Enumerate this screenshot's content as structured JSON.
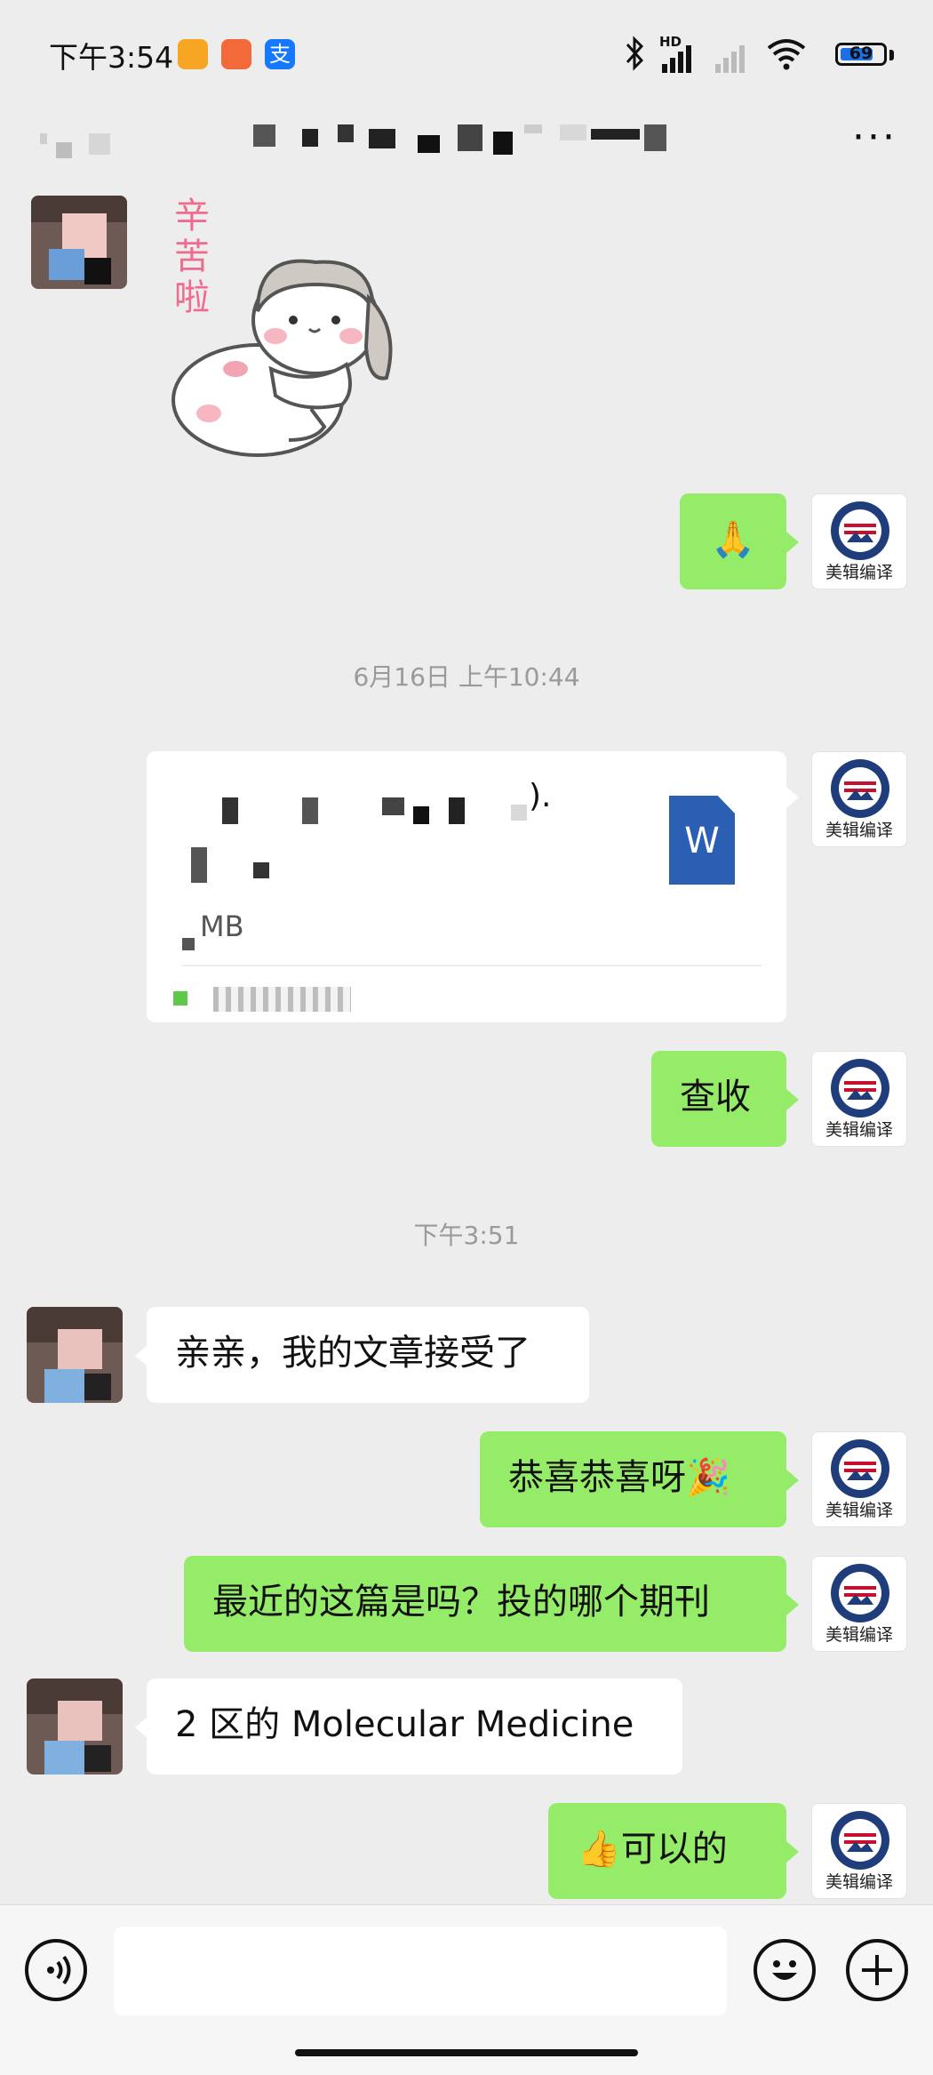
{
  "status_bar": {
    "time": "下午3:54",
    "alipay_glyph": "支",
    "battery": "69",
    "network_label": "HD",
    "icons": [
      "notification-icon-orange",
      "notification-icon-red",
      "alipay-icon",
      "bluetooth-icon",
      "signal-icon",
      "wifi-icon",
      "battery-icon"
    ]
  },
  "header": {
    "title": "",
    "more": "···"
  },
  "colors": {
    "background": "#ededed",
    "sent_bubble": "#95ec69",
    "received_bubble": "#ffffff",
    "timestamp": "#9a9a9a",
    "word_icon": "#2b5fb4"
  },
  "brand": {
    "name": "美辑编译",
    "seal_text": "AMERICAN EDITING"
  },
  "messages": {
    "sticker_text": "辛苦啦",
    "sent_prayer": "🙏",
    "time1": "6月16日 上午10:44",
    "file": {
      "title": ").",
      "size": "MB",
      "icon_letter": "W"
    },
    "sent_check": "查收",
    "time2": "下午3:51",
    "recv_accept": "亲亲，我的文章接受了",
    "sent_congrats": "恭喜恭喜呀🎉",
    "sent_question": "最近的这篇是吗？投的哪个期刊",
    "recv_journal": "2 区的 Molecular Medicine",
    "sent_ok": "👍可以的"
  },
  "input_bar": {
    "voice_icon": "voice-icon",
    "emoji_icon": "emoji-icon",
    "plus_icon": "plus-icon"
  }
}
